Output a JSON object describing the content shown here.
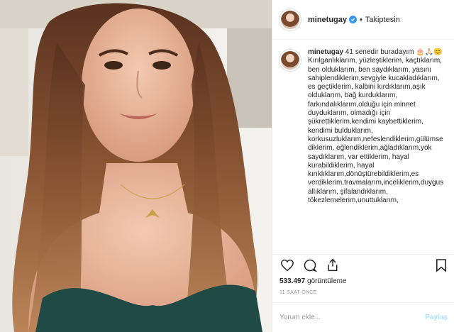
{
  "post": {
    "username": "minetugay",
    "separator": "•",
    "follow_status": "Takiptesin",
    "caption_username": "minetugay",
    "caption_text": "41 senedir buradayım 🎂🙏🏻😊Kırılganlıklarım, yüzleştiklerim, kaçtıklarım, ben olduklarım, ben saydıklarım, yasını sahiplendiklerim,sevgiyle kucakladıklarım, es geçtiklerim, kalbini kırdıklarım,aşık olduklarım, bağ kurduklarım, farkındalıklarım,olduğu için minnet duyduklarım, olmadığı için şükrettiklerim,kendimi kaybettiklerim, kendimi bulduklarım, korkusuzluklarım,nefeslendiklerim,gülümsediklerim, eğlendiklerim,ağladıklarım,yok saydıklarım, var ettiklerim, hayal kurabildiklerim, hayal kırıklıklarım,dönüştürebildiklerim,es verdiklerim,travmalarım,inceliklerim,duygusallıklarım, şifalandıklarım, tökezlemelerim,unuttuklarım,",
    "views_count": "533.497",
    "views_label": "görüntüleme",
    "time_ago": "11 SAAT ÖNCE",
    "comment_placeholder": "Yorum ekle...",
    "post_button": "Paylaş"
  },
  "icons": {
    "verified": "verified-badge-icon",
    "like": "heart-icon",
    "comment": "comment-bubble-icon",
    "share": "share-icon",
    "save": "bookmark-icon"
  },
  "colors": {
    "verified": "#3897f0",
    "post_button_disabled": "#b2dffc",
    "muted_text": "#999999",
    "border": "#efefef"
  }
}
